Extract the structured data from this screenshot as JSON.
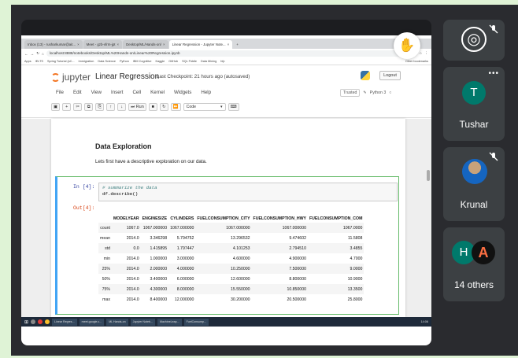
{
  "browser": {
    "tabs": [
      {
        "label": "Inbox (13) - rusharkumar@ait..."
      },
      {
        "label": "Meet - gzb-vfrm-jpt"
      },
      {
        "label": "Desktop/ML/Hands-on/"
      },
      {
        "label": "Linear Regression - Jupyter Note..."
      }
    ],
    "url": "localhost:8888/notebooks/Desktop/ML%20Hands-on/Linear%20Regression.ipynb",
    "bookmarks": [
      "Apps",
      "IELTS",
      "Spring Tutorial (sC...",
      "Immigration",
      "Data Science",
      "Python",
      "IBM Cognitive",
      "Kaggle",
      "GitHub",
      "SQL Fiddle",
      "Data Mining",
      "hfp"
    ],
    "bookmarks_right": "Other bookmarks"
  },
  "jupyter": {
    "logo": "jupyter",
    "notebook_title": "Linear Regression",
    "checkpoint": "Last Checkpoint: 21 hours ago  (autosaved)",
    "logout": "Logout",
    "menu": [
      "File",
      "Edit",
      "View",
      "Insert",
      "Cell",
      "Kernel",
      "Widgets",
      "Help"
    ],
    "trusted": "Trusted",
    "kernel": "Python 3",
    "toolbar": {
      "run": "Run",
      "celltype": "Code"
    }
  },
  "notebook": {
    "heading": "Data Exploration",
    "description": "Lets first have a descriptive exploration on our data.",
    "in_prompt": "In [4]:",
    "out_prompt": "Out[4]:",
    "code_comment": "# summarize the data",
    "code_line": "df.describe()",
    "table": {
      "columns": [
        "",
        "MODELYEAR",
        "ENGINESIZE",
        "CYLINDERS",
        "FUELCONSUMPTION_CITY",
        "FUELCONSUMPTION_HWY",
        "FUELCONSUMPTION_COM"
      ],
      "rows": [
        [
          "count",
          "1067.0",
          "1067.000000",
          "1067.000000",
          "1067.000000",
          "1067.000000",
          "1067.0000"
        ],
        [
          "mean",
          "2014.0",
          "3.346298",
          "5.794752",
          "13.296532",
          "9.474602",
          "11.5808"
        ],
        [
          "std",
          "0.0",
          "1.415895",
          "1.797447",
          "4.101253",
          "2.794510",
          "3.4855"
        ],
        [
          "min",
          "2014.0",
          "1.000000",
          "3.000000",
          "4.600000",
          "4.900000",
          "4.7000"
        ],
        [
          "25%",
          "2014.0",
          "2.000000",
          "4.000000",
          "10.250000",
          "7.500000",
          "9.0000"
        ],
        [
          "50%",
          "2014.0",
          "3.400000",
          "6.000000",
          "12.600000",
          "8.800000",
          "10.9000"
        ],
        [
          "75%",
          "2014.0",
          "4.300000",
          "8.000000",
          "15.550000",
          "10.850000",
          "13.3500"
        ],
        [
          "max",
          "2014.0",
          "8.400000",
          "12.000000",
          "30.200000",
          "20.500000",
          "25.8000"
        ]
      ]
    }
  },
  "taskbar": {
    "items": [
      "Linear Regres...",
      "meet.google.c...",
      "ML Hands-on",
      "Jupyter Noteb...",
      "MachineLeap...",
      "FuelConsump..."
    ],
    "time": "14:06"
  },
  "participants": [
    {
      "name": "Tushar",
      "initial": "T",
      "color": "#00796b"
    },
    {
      "name": "Krunal"
    },
    {
      "name": "14 others",
      "initial": "H",
      "color": "#00796b"
    }
  ]
}
